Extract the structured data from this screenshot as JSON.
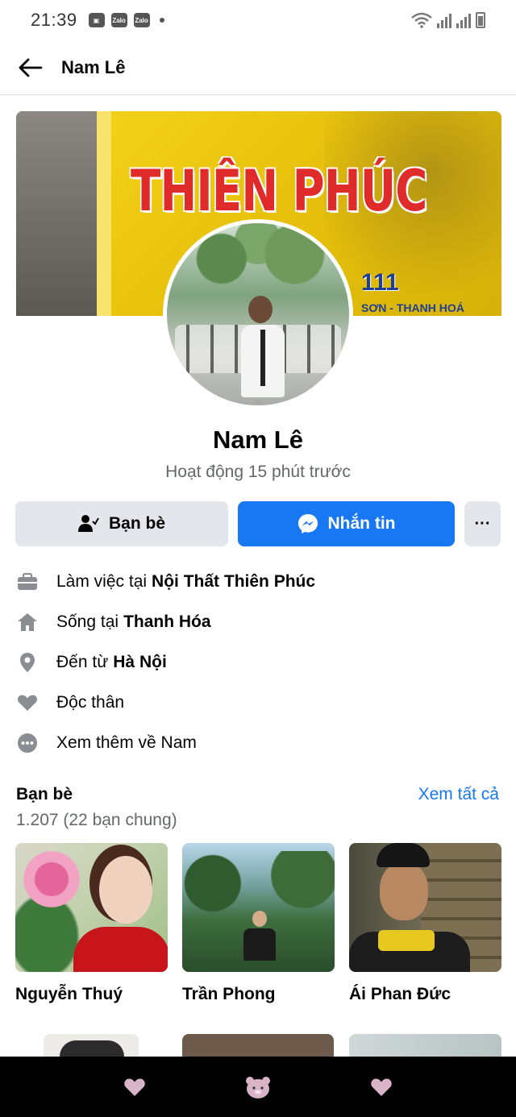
{
  "status_bar": {
    "time": "21:39",
    "notification_icons": [
      "gallery-icon",
      "zalo-icon",
      "zalo-icon"
    ],
    "zalo_label": "Zalo"
  },
  "header": {
    "title": "Nam Lê"
  },
  "cover": {
    "sign_text": "THIÊN PHÚC",
    "sign_number": "111",
    "sign_subtext": "SƠN - THANH HOÁ"
  },
  "profile": {
    "name": "Nam Lê",
    "status": "Hoạt động 15 phút trước"
  },
  "actions": {
    "friends_label": "Bạn bè",
    "message_label": "Nhắn tin",
    "more_label": "···"
  },
  "info": {
    "work_prefix": "Làm việc tại",
    "work_value": "Nội Thất Thiên Phúc",
    "lives_prefix": "Sống tại",
    "lives_value": "Thanh Hóa",
    "from_prefix": "Đến từ",
    "from_value": "Hà Nội",
    "relationship": "Độc thân",
    "see_more": "Xem thêm về Nam"
  },
  "friends": {
    "title": "Bạn bè",
    "see_all": "Xem tất cả",
    "count": "1.207 (22 bạn chung)",
    "items": [
      {
        "name": "Nguyễn Thuý"
      },
      {
        "name": "Trần Phong"
      },
      {
        "name": "Ái Phan Đức"
      }
    ]
  },
  "colors": {
    "accent": "#1877f2",
    "secondary_button": "#e4e6eb",
    "muted_text": "#65676b"
  }
}
